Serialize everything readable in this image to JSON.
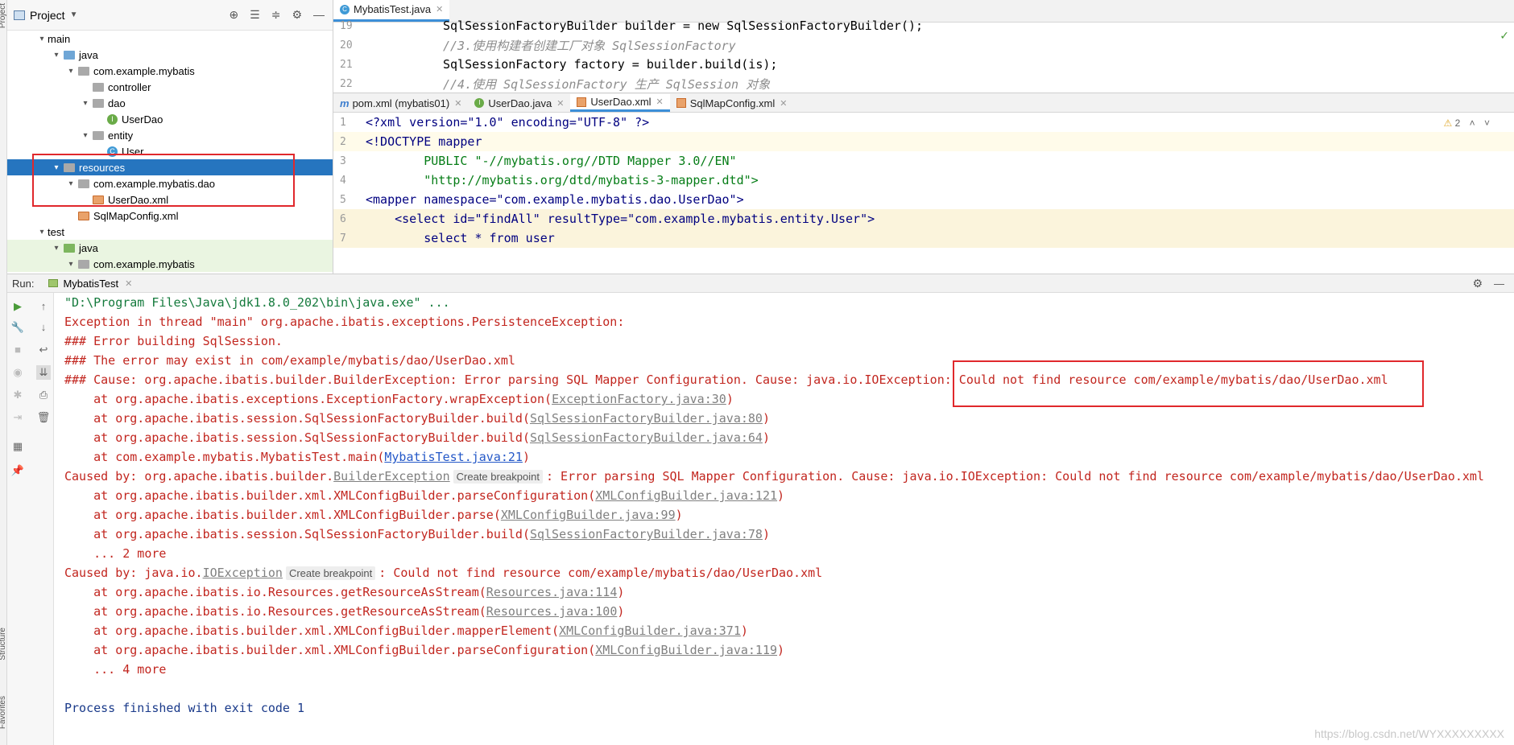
{
  "project": {
    "title": "Project",
    "tree": [
      {
        "label": "main"
      },
      {
        "label": "java"
      },
      {
        "label": "com.example.mybatis"
      },
      {
        "label": "controller"
      },
      {
        "label": "dao"
      },
      {
        "label": "UserDao"
      },
      {
        "label": "entity"
      },
      {
        "label": "User"
      },
      {
        "label": "resources"
      },
      {
        "label": "com.example.mybatis.dao"
      },
      {
        "label": "UserDao.xml"
      },
      {
        "label": "SqlMapConfig.xml"
      },
      {
        "label": "test"
      },
      {
        "label": "java"
      },
      {
        "label": "com.example.mybatis"
      }
    ]
  },
  "editor_top": {
    "tab": "MybatisTest.java",
    "lines": [
      {
        "num": "19",
        "text": "SqlSessionFactoryBuilder builder = new SqlSessionFactoryBuilder();"
      },
      {
        "num": "20",
        "text": "//3.使用构建者创建工厂对象 SqlSessionFactory"
      },
      {
        "num": "21",
        "text": "SqlSessionFactory factory = builder.build(is);"
      },
      {
        "num": "22",
        "text": "//4.使用 SqlSessionFactory 生产 SqlSession 对象"
      }
    ]
  },
  "editor_bottom": {
    "tabs": [
      "pom.xml (mybatis01)",
      "UserDao.java",
      "UserDao.xml",
      "SqlMapConfig.xml"
    ],
    "warning_count": "2",
    "lines": [
      {
        "num": "1",
        "text": "<?xml version=\"1.0\" encoding=\"UTF-8\" ?>"
      },
      {
        "num": "2",
        "text": "<!DOCTYPE mapper"
      },
      {
        "num": "3",
        "text": "        PUBLIC \"-//mybatis.org//DTD Mapper 3.0//EN\""
      },
      {
        "num": "4",
        "text": "        \"http://mybatis.org/dtd/mybatis-3-mapper.dtd\">"
      },
      {
        "num": "5",
        "text": "<mapper namespace=\"com.example.mybatis.dao.UserDao\">"
      },
      {
        "num": "6",
        "text": "    <select id=\"findAll\" resultType=\"com.example.mybatis.entity.User\">"
      },
      {
        "num": "7",
        "text": "        select * from user"
      }
    ]
  },
  "run": {
    "label": "Run:",
    "tab": "MybatisTest",
    "create_breakpoint": "Create breakpoint",
    "console": [
      {
        "t": "\"D:\\Program Files\\Java\\jdk1.8.0_202\\bin\\java.exe\" ..."
      },
      {
        "t": "Exception in thread \"main\" org.apache.ibatis.exceptions.PersistenceException: "
      },
      {
        "t": "### Error building SqlSession."
      },
      {
        "t": "### The error may exist in com/example/mybatis/dao/UserDao.xml"
      },
      {
        "t": "### Cause: org.apache.ibatis.builder.BuilderException: Error parsing SQL Mapper Configuration. Cause: java.io.IOException: ",
        "t2": "Could not find resource com/example/mybatis/dao/UserDao.xml"
      },
      {
        "t": "    at org.apache.ibatis.exceptions.ExceptionFactory.wrapException(",
        "link": "ExceptionFactory.java:30",
        "end": ")"
      },
      {
        "t": "    at org.apache.ibatis.session.SqlSessionFactoryBuilder.build(",
        "link": "SqlSessionFactoryBuilder.java:80",
        "end": ")"
      },
      {
        "t": "    at org.apache.ibatis.session.SqlSessionFactoryBuilder.build(",
        "link": "SqlSessionFactoryBuilder.java:64",
        "end": ")"
      },
      {
        "t": "    at com.example.mybatis.MybatisTest.main(",
        "link": "MybatisTest.java:21",
        "end": ")"
      },
      {
        "t": "Caused by: org.apache.ibatis.builder.",
        "exc": "BuilderException",
        "t2": ": Error parsing SQL Mapper Configuration. Cause: java.io.IOException: Could not find resource com/example/mybatis/dao/UserDao.xml"
      },
      {
        "t": "    at org.apache.ibatis.builder.xml.XMLConfigBuilder.parseConfiguration(",
        "link": "XMLConfigBuilder.java:121",
        "end": ")"
      },
      {
        "t": "    at org.apache.ibatis.builder.xml.XMLConfigBuilder.parse(",
        "link": "XMLConfigBuilder.java:99",
        "end": ")"
      },
      {
        "t": "    at org.apache.ibatis.session.SqlSessionFactoryBuilder.build(",
        "link": "SqlSessionFactoryBuilder.java:78",
        "end": ")"
      },
      {
        "t": "    ... 2 more"
      },
      {
        "t": "Caused by: java.io.",
        "exc": "IOException",
        "t2": ": Could not find resource com/example/mybatis/dao/UserDao.xml"
      },
      {
        "t": "    at org.apache.ibatis.io.Resources.getResourceAsStream(",
        "link": "Resources.java:114",
        "end": ")"
      },
      {
        "t": "    at org.apache.ibatis.io.Resources.getResourceAsStream(",
        "link": "Resources.java:100",
        "end": ")"
      },
      {
        "t": "    at org.apache.ibatis.builder.xml.XMLConfigBuilder.mapperElement(",
        "link": "XMLConfigBuilder.java:371",
        "end": ")"
      },
      {
        "t": "    at org.apache.ibatis.builder.xml.XMLConfigBuilder.parseConfiguration(",
        "link": "XMLConfigBuilder.java:119",
        "end": ")"
      },
      {
        "t": "    ... 4 more"
      },
      {
        "t": ""
      },
      {
        "t": "Process finished with exit code 1"
      }
    ]
  },
  "side_labels": {
    "structure": "Structure",
    "favorites": "Favorites",
    "project": "Project"
  },
  "watermark": "https://blog.csdn.net/WYXXXXXXXXX",
  "colors": {
    "accent": "#2675bf",
    "error": "#c2261f",
    "highlight_box": "#e0282c"
  }
}
